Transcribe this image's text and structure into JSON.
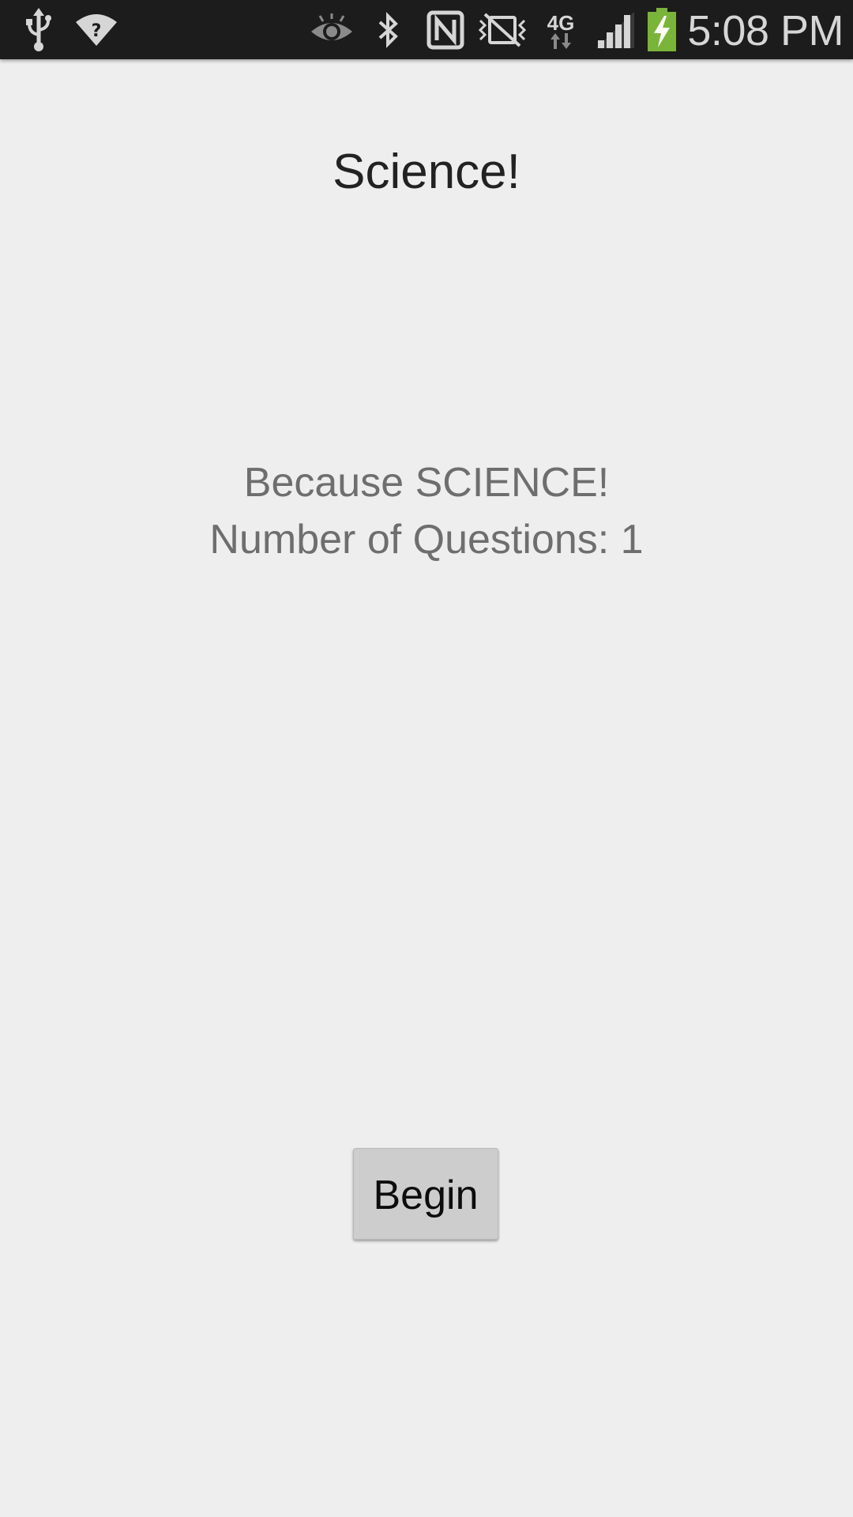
{
  "status_bar": {
    "time": "5:08 PM",
    "network_label": "4G",
    "icons": [
      "usb-icon",
      "wifi-question-icon",
      "eye-icon",
      "bluetooth-icon",
      "nfc-icon",
      "vibrate-mute-icon",
      "network-4g-icon",
      "signal-icon",
      "battery-charging-icon"
    ],
    "battery_fill": 0.95,
    "colors": {
      "background": "#1c1c1c",
      "icon": "#d6d6d6",
      "battery_green": "#7ab43a"
    }
  },
  "main": {
    "title": "Science!",
    "description": "Because SCIENCE!",
    "question_count": "Number of Questions: 1",
    "begin_label": "Begin"
  },
  "colors": {
    "background": "#eeeeee",
    "title_text": "#222222",
    "subtitle_text": "#6e6e6e",
    "button_bg": "#cdcdcd"
  }
}
